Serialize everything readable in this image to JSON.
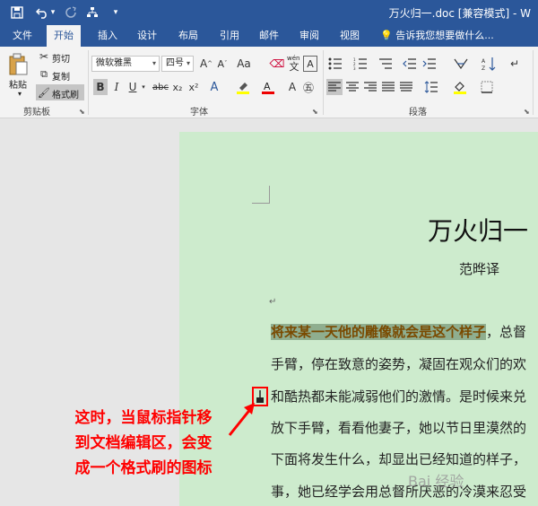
{
  "quick_access": {
    "save_icon": "save-icon",
    "undo_icon": "undo-icon",
    "undo_dropdown": "▾",
    "redo_icon": "redo-icon",
    "custom_icon": "tree-icon",
    "more": "▾"
  },
  "window": {
    "title": "万火归一.doc [兼容模式] - W"
  },
  "tabs": [
    {
      "label": "文件"
    },
    {
      "label": "开始"
    },
    {
      "label": "插入"
    },
    {
      "label": "设计"
    },
    {
      "label": "布局"
    },
    {
      "label": "引用"
    },
    {
      "label": "邮件"
    },
    {
      "label": "审阅"
    },
    {
      "label": "视图"
    }
  ],
  "tell_me": "告诉我您想要做什么...",
  "clipboard": {
    "paste": "粘贴",
    "cut": "剪切",
    "copy": "复制",
    "format_painter": "格式刷",
    "group_label": "剪贴板"
  },
  "font": {
    "font_name": "微软雅黑",
    "font_size": "四号",
    "wen": "wén",
    "bold": "B",
    "italic": "I",
    "underline": "U",
    "strike": "abc",
    "subscript": "x₂",
    "superscript": "x²",
    "group_label": "字体"
  },
  "paragraph": {
    "group_label": "段落"
  },
  "document": {
    "title": "万火归一",
    "author": "范晔译",
    "para_mark": "↵",
    "lines": [
      {
        "highlight": "将来某一天他的雕像就会是这个样子",
        "rest": "，总督"
      },
      {
        "text": "手臂，停在致意的姿势，凝固在观众们的欢"
      },
      {
        "text": "和酷热都未能减弱他们的激情。是时候来兑"
      },
      {
        "text": "放下手臂，看看他妻子，她以节日里漠然的"
      },
      {
        "text": "下面将发生什么，却显出已经知道的样子，"
      },
      {
        "text": "事，她已经学会用总督所厌恶的冷漠来忍受"
      }
    ]
  },
  "annotation": [
    "这时，当鼠标指针移",
    "到文档编辑区，会变",
    "成一个格式刷的图标"
  ],
  "watermark": "Bai 经验",
  "colors": {
    "title_bar": "#2b579a",
    "page": "#cdebcd",
    "annotation": "#ff0000",
    "highlight": "#8fae8f"
  }
}
